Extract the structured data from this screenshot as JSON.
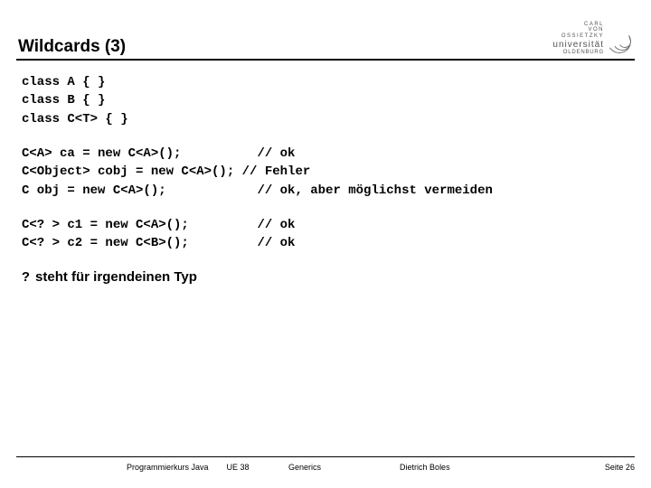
{
  "header": {
    "title": "Wildcards (3)",
    "logo": {
      "line1": "CARL",
      "line2": "VON",
      "line3": "OSSIETZKY",
      "word": "universität",
      "city": "OLDENBURG"
    }
  },
  "code": {
    "block1": "class A { }\nclass B { }\nclass C<T> { }",
    "block2": "C<A> ca = new C<A>();          // ok\nC<Object> cobj = new C<A>(); // Fehler\nC obj = new C<A>();            // ok, aber möglichst vermeiden",
    "block3": "C<? > c1 = new C<A>();         // ok\nC<? > c2 = new C<B>();         // ok"
  },
  "note": {
    "symbol": "?",
    "text": "steht für irgendeinen Typ"
  },
  "footer": {
    "course": "Programmierkurs Java",
    "unit": "UE 38",
    "topic": "Generics",
    "author": "Dietrich Boles",
    "page": "Seite 26"
  }
}
